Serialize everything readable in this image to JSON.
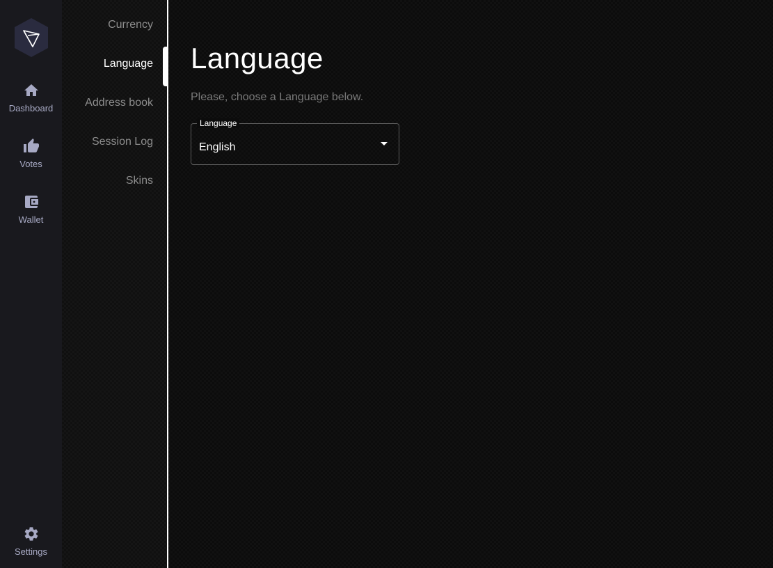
{
  "rail": {
    "logo_icon": "tron-logo-icon",
    "items": [
      {
        "label": "Dashboard",
        "icon": "home-icon"
      },
      {
        "label": "Votes",
        "icon": "thumbs-up-icon"
      },
      {
        "label": "Wallet",
        "icon": "wallet-icon"
      }
    ],
    "settings": {
      "label": "Settings",
      "icon": "gear-icon"
    }
  },
  "submenu": {
    "items": [
      {
        "label": "Currency",
        "active": false
      },
      {
        "label": "Language",
        "active": true
      },
      {
        "label": "Address book",
        "active": false
      },
      {
        "label": "Session Log",
        "active": false
      },
      {
        "label": "Skins",
        "active": false
      }
    ]
  },
  "main": {
    "title": "Language",
    "subtitle": "Please, choose a Language below.",
    "select": {
      "legend": "Language",
      "value": "English"
    }
  },
  "colors": {
    "rail_bg": "#19191e",
    "rail_icon": "#a7a9c4",
    "content_bg": "#0c0c0c",
    "active_text": "#ffffff",
    "inactive_text": "#8d8d8d"
  }
}
